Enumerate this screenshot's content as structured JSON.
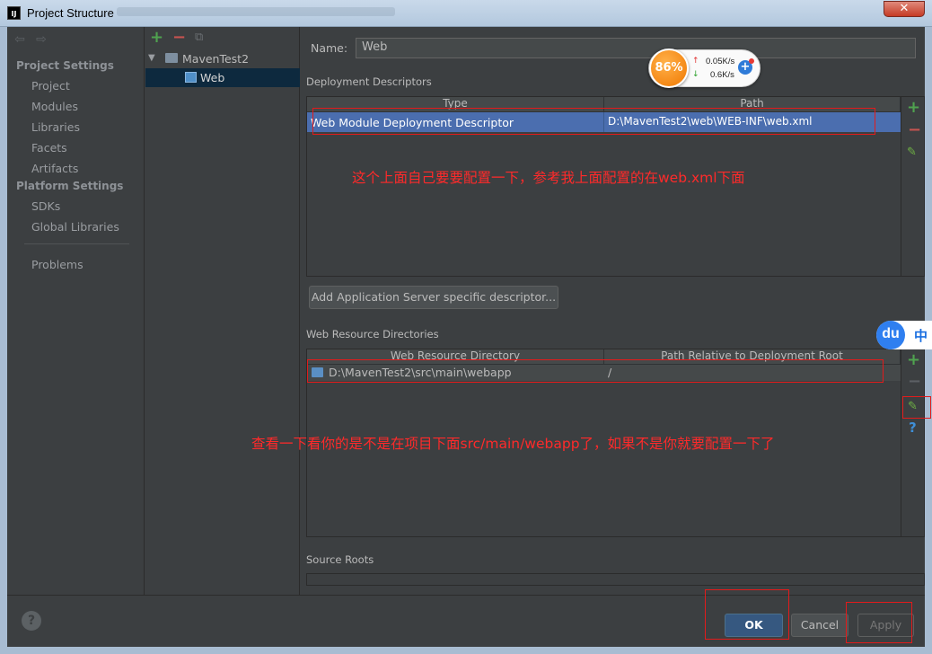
{
  "window": {
    "title": "Project Structure",
    "close_glyph": "✕"
  },
  "nav": {
    "back_icon": "arrow-left-icon",
    "forward_icon": "arrow-right-icon",
    "project_settings_header": "Project Settings",
    "project_settings_items": [
      "Project",
      "Modules",
      "Libraries",
      "Facets",
      "Artifacts"
    ],
    "platform_settings_header": "Platform Settings",
    "platform_settings_items": [
      "SDKs",
      "Global Libraries"
    ],
    "problems": "Problems"
  },
  "tree": {
    "toolbar": {
      "add": "+",
      "remove": "−",
      "copy": "⧉"
    },
    "module": "MavenTest2",
    "facet": "Web"
  },
  "facet": {
    "name_label": "Name:",
    "name_value": "Web",
    "deployment_descriptors": {
      "title": "Deployment Descriptors",
      "columns": [
        "Type",
        "Path"
      ],
      "rows": [
        {
          "type": "Web Module Deployment Descriptor",
          "path": "D:\\MavenTest2\\web\\WEB-INF\\web.xml"
        }
      ],
      "add_server_button": "Add Application Server specific descriptor..."
    },
    "web_resource_directories": {
      "title": "Web Resource Directories",
      "columns": [
        "Web Resource Directory",
        "Path Relative to Deployment Root"
      ],
      "rows": [
        {
          "directory": "D:\\MavenTest2\\src\\main\\webapp",
          "relative_path": "/"
        }
      ]
    },
    "source_roots": {
      "title": "Source Roots"
    }
  },
  "side_toolbar": {
    "add": "+",
    "remove": "−",
    "edit_icon": "pencil-icon",
    "help": "?"
  },
  "annotations": {
    "note1": "这个上面自己要要配置一下，参考我上面配置的在web.xml下面",
    "note2": "查看一下看你的是不是在项目下面src/main/webapp了，如果不是你就要配置一下了"
  },
  "speed_widget": {
    "percent": "86%",
    "upload": "0.05K/s",
    "download": "0.6K/s",
    "plus": "+"
  },
  "du_widget": {
    "logo": "du",
    "lang": "中"
  },
  "buttons": {
    "help": "?",
    "ok": "OK",
    "cancel": "Cancel",
    "apply": "Apply"
  },
  "colors": {
    "accent_selection": "#4b6eaf",
    "annotation_red": "#e21b1b",
    "ok_button": "#365880"
  }
}
